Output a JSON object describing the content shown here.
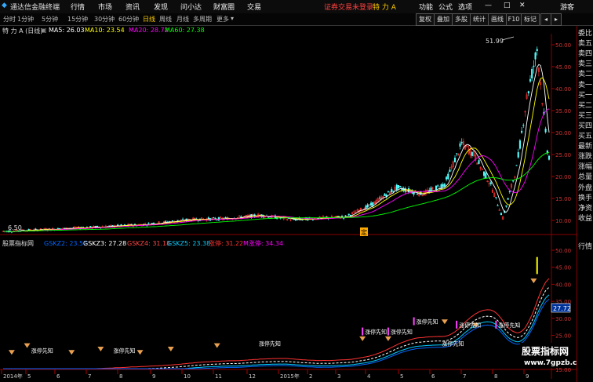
{
  "menubar": {
    "logo_text": "通达信金融终端",
    "items": [
      "行情",
      "市场",
      "资讯",
      "发现",
      "问小达",
      "财富圈",
      "交易"
    ],
    "login_notice": "证券交易未登录",
    "stock_name": "特 力 A",
    "right_items": [
      "功能",
      "公式",
      "选项"
    ],
    "guest_label": "游客"
  },
  "timeframes": [
    "分时",
    "1分钟",
    "5分钟",
    "15分钟",
    "30分钟",
    "60分钟",
    "日线",
    "周线",
    "月线",
    "多周期",
    "更多"
  ],
  "toolbar_right": [
    "复权",
    "叠加",
    "多股",
    "统计",
    "画线",
    "F10",
    "标记"
  ],
  "ma_bar": {
    "title": "特 力 A (日线)",
    "items": [
      {
        "label": "MA5: 26.03",
        "color": "#ffffff"
      },
      {
        "label": "MA10: 23.54",
        "color": "#ffff00"
      },
      {
        "label": "MA20: 28.72",
        "color": "#ff00ff"
      },
      {
        "label": "MA60: 27.38",
        "color": "#00ff00"
      }
    ]
  },
  "main_chart": {
    "price_ticks": [
      "50.00",
      "45.00",
      "40.00",
      "35.00",
      "30.00",
      "25.00",
      "20.00",
      "15.00",
      "10.00"
    ],
    "high_label": "51.99",
    "low_label": "6.50",
    "marker_label": "定"
  },
  "indicator_bar": {
    "title": "股票指标网",
    "items": [
      {
        "label": "GSKZ2: 23.57",
        "color": "#0066ff"
      },
      {
        "label": "GSKZ3: 27.28",
        "color": "#ffffff"
      },
      {
        "label": "GSKZ4: 31.18",
        "color": "#ff4444"
      },
      {
        "label": "GSKZ5: 23.38",
        "color": "#00ccff"
      },
      {
        "label": "涨停: 31.22",
        "color": "#ff3333"
      },
      {
        "label": "M涨停: 34.34",
        "color": "#ff00ff"
      }
    ]
  },
  "sub_chart": {
    "ticks": [
      "50.00",
      "45.00",
      "40.00",
      "35.00",
      "30.00",
      "25.00",
      "20.00",
      "15.00"
    ],
    "current_value": "27.72",
    "signal_label": "涨停先知"
  },
  "date_axis": {
    "labels": [
      "2014年",
      "5",
      "6",
      "7",
      "8",
      "9",
      "10",
      "11",
      "12",
      "2015年",
      "2",
      "3",
      "4",
      "5",
      "6",
      "7",
      "8",
      "9"
    ]
  },
  "right_panel": [
    "委比",
    "卖五",
    "卖四",
    "卖三",
    "卖二",
    "卖一",
    "买一",
    "买二",
    "买三",
    "买四",
    "买五",
    "最新",
    "涨跌",
    "涨幅",
    "总量",
    "外盘",
    "换手",
    "净资",
    "收益",
    "行情"
  ],
  "watermark": {
    "title": "股票指标网",
    "url": "www.7gpzb.com"
  },
  "colors": {
    "accent_red": "#ff3333",
    "ma5": "#ffffff",
    "ma10": "#ffff00",
    "ma20": "#ff00ff",
    "ma60": "#00ff00"
  }
}
